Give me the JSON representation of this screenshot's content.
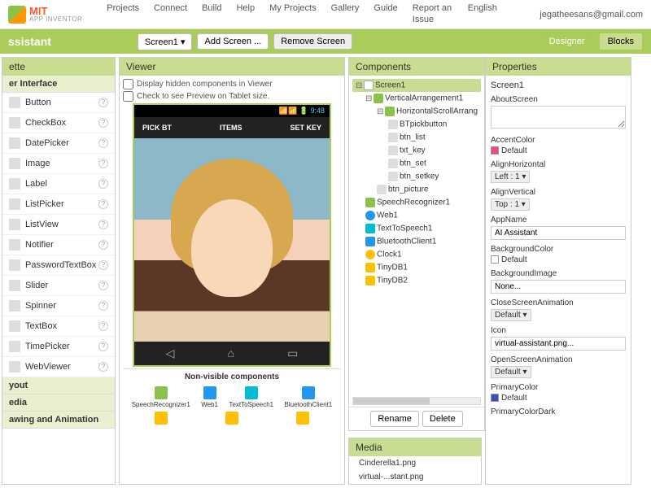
{
  "brand": {
    "mit": "MIT",
    "sub": "APP INVENTOR"
  },
  "menu": [
    "Projects",
    "Connect",
    "Build",
    "Help",
    "My Projects",
    "Gallery",
    "Guide",
    "Report an Issue",
    "English"
  ],
  "user_email": "jegatheesans@gmail.com",
  "project_title": "ssistant",
  "toolbar": {
    "screen": "Screen1",
    "add": "Add Screen ...",
    "remove": "Remove Screen",
    "designer": "Designer",
    "blocks": "Blocks"
  },
  "palette": {
    "title": "ette",
    "cat_ui": "er Interface",
    "items": [
      "Button",
      "CheckBox",
      "DatePicker",
      "Image",
      "Label",
      "ListPicker",
      "ListView",
      "Notifier",
      "PasswordTextBox",
      "Slider",
      "Spinner",
      "TextBox",
      "TimePicker",
      "WebViewer"
    ],
    "cat_layout": "yout",
    "cat_media": "edia",
    "cat_drawing": "awing and Animation"
  },
  "viewer": {
    "title": "Viewer",
    "chk1": "Display hidden components in Viewer",
    "chk2": "Check to see Preview on Tablet size.",
    "time": "9:48",
    "btns": [
      "PICK BT",
      "ITEMS",
      "SET KEY"
    ],
    "nonvis_title": "Non-visible components",
    "nonvis": [
      "SpeechRecognizer1",
      "Web1",
      "TextToSpeech1",
      "BluetoothClient1"
    ]
  },
  "components": {
    "title": "Components",
    "tree": {
      "screen": "Screen1",
      "vert": "VerticalArrangement1",
      "horiz": "HorizontalScrollArrang",
      "items": [
        "BTpickbutton",
        "btn_list",
        "txt_key",
        "btn_set",
        "btn_setkey"
      ],
      "rest": [
        "btn_picture",
        "SpeechRecognizer1",
        "Web1",
        "TextToSpeech1",
        "BluetoothClient1",
        "Clock1",
        "TinyDB1",
        "TinyDB2"
      ]
    },
    "rename": "Rename",
    "delete": "Delete"
  },
  "media": {
    "title": "Media",
    "items": [
      "Cinderella1.png",
      "virtual-...stant.png"
    ]
  },
  "properties": {
    "title": "Properties",
    "target": "Screen1",
    "about": "AboutScreen",
    "accent": "AccentColor",
    "accent_val": "Default",
    "alignH": "AlignHorizontal",
    "alignH_val": "Left : 1",
    "alignV": "AlignVertical",
    "alignV_val": "Top : 1",
    "appname": "AppName",
    "appname_val": "AI Assistant",
    "bgcolor": "BackgroundColor",
    "bgcolor_val": "Default",
    "bgimg": "BackgroundImage",
    "bgimg_val": "None...",
    "closeanim": "CloseScreenAnimation",
    "closeanim_val": "Default",
    "icon": "Icon",
    "icon_val": "virtual-assistant.png...",
    "openanim": "OpenScreenAnimation",
    "openanim_val": "Default",
    "primcolor": "PrimaryColor",
    "primcolor_val": "Default",
    "primcolordark": "PrimaryColorDark"
  }
}
